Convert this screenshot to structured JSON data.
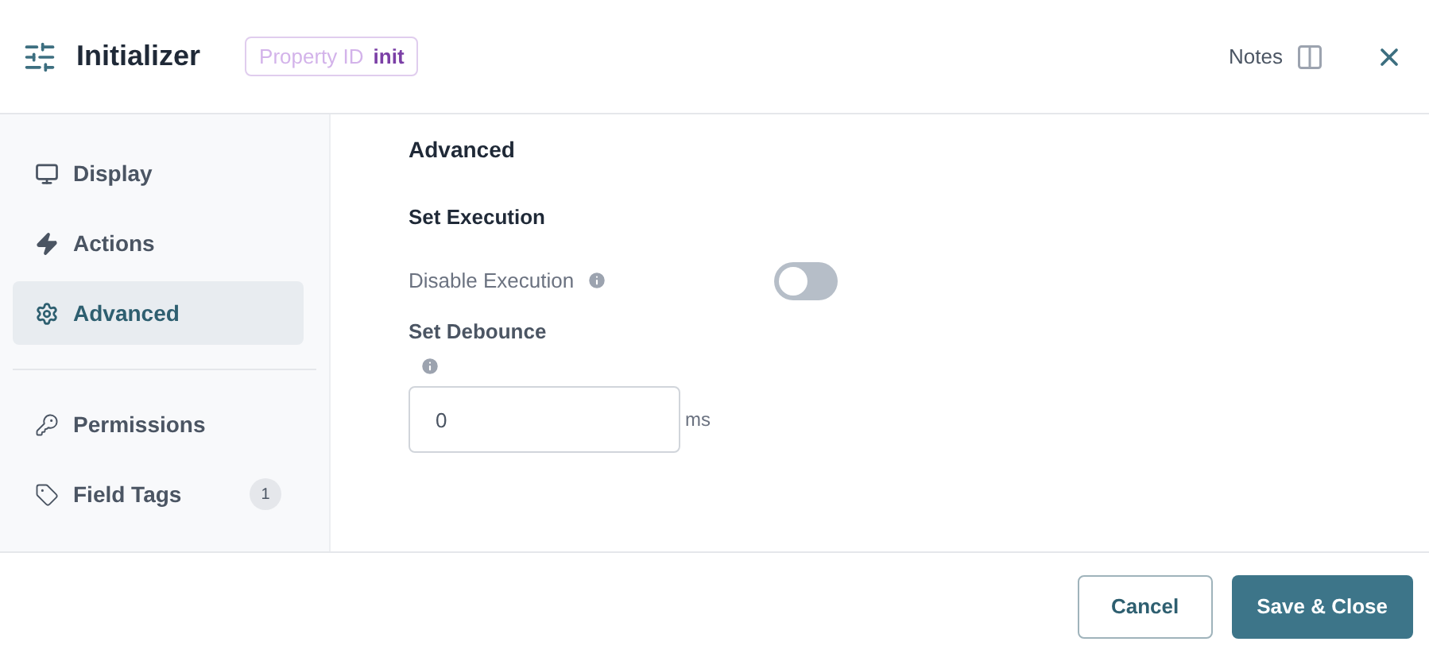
{
  "header": {
    "title": "Initializer",
    "property_label": "Property ID",
    "property_value": "init",
    "notes_label": "Notes"
  },
  "sidebar": {
    "groups": [
      [
        {
          "label": "Display",
          "kind": "monitor",
          "selected": false
        },
        {
          "label": "Actions",
          "kind": "bolt",
          "selected": false
        },
        {
          "label": "Advanced",
          "kind": "gear",
          "selected": true
        }
      ],
      [
        {
          "label": "Permissions",
          "kind": "key",
          "selected": false
        },
        {
          "label": "Field Tags",
          "kind": "tag",
          "selected": false,
          "badge": "1"
        }
      ]
    ]
  },
  "content": {
    "heading": "Advanced",
    "section": "Set Execution",
    "toggle": {
      "label": "Disable Execution",
      "on": false
    },
    "debounce": {
      "label": "Set Debounce",
      "value": "0",
      "unit": "ms"
    }
  },
  "footer": {
    "buttons": [
      {
        "label": "Cancel",
        "kind": "secondary"
      },
      {
        "label": "Save & Close",
        "kind": "primary"
      }
    ]
  }
}
